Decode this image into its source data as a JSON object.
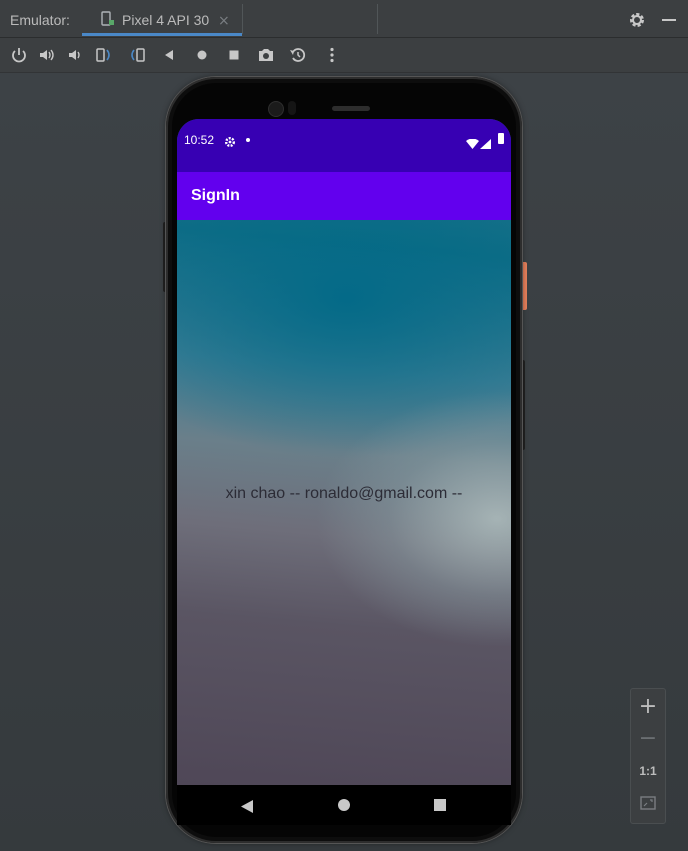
{
  "panel": {
    "label": "Emulator:",
    "tab_label": "Pixel 4 API 30",
    "tab_close": "×"
  },
  "toolbar": {
    "buttons": [
      "power-icon",
      "volume-up-icon",
      "volume-down-icon",
      "rotate-left-icon",
      "rotate-right-icon",
      "back-icon",
      "home-icon",
      "overview-icon",
      "camera-icon",
      "snapshot-icon",
      "more-icon"
    ]
  },
  "device": {
    "status": {
      "time": "10:52"
    },
    "appbar": {
      "title": "SignIn"
    },
    "content": {
      "message": "xin chao -- ronaldo@gmail.com --"
    }
  },
  "zoom": {
    "plus": "+",
    "minus": "−",
    "one_to_one": "1:1"
  },
  "colors": {
    "status_bar": "#3700b3",
    "app_bar": "#6200ee",
    "accent": "#4a88c7"
  }
}
